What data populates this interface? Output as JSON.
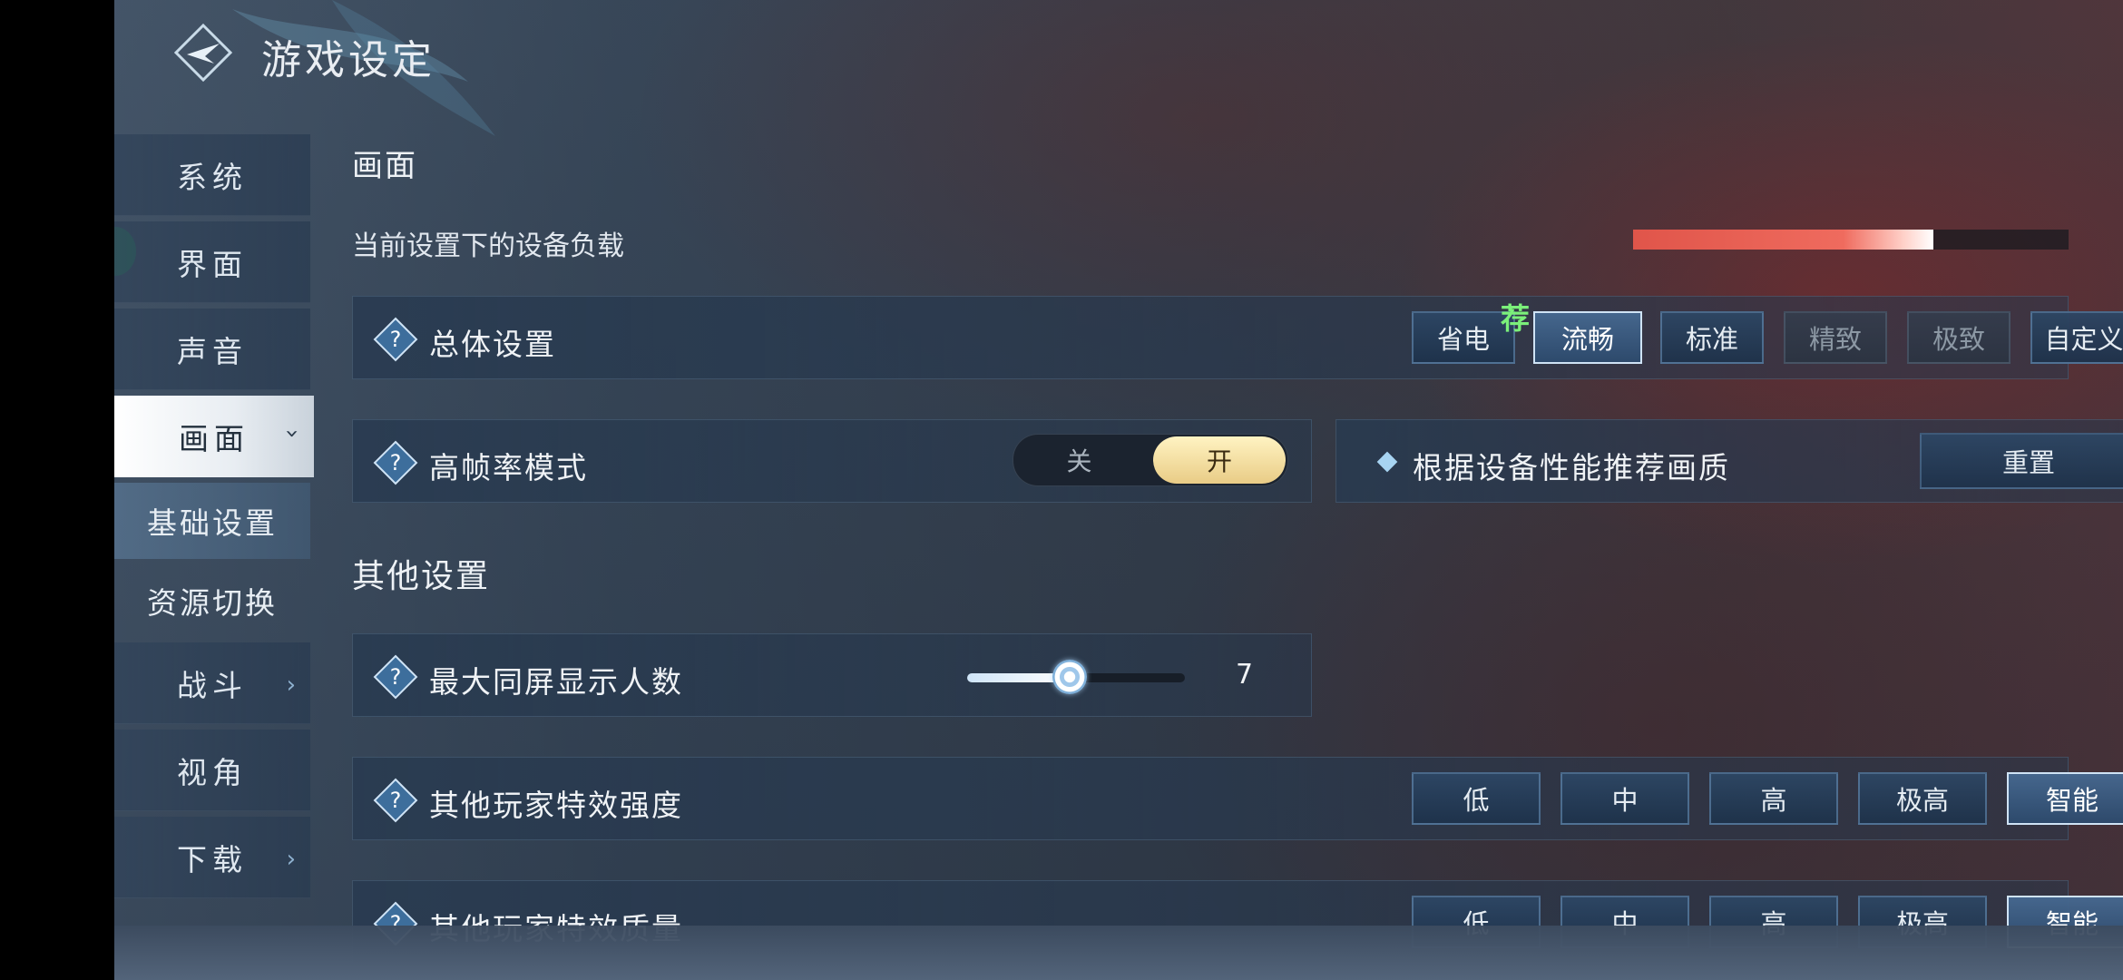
{
  "header": {
    "title": "游戏设定"
  },
  "sidebar": {
    "items": [
      {
        "label": "系统"
      },
      {
        "label": "界面"
      },
      {
        "label": "声音"
      },
      {
        "label": "画面"
      },
      {
        "label": "战斗"
      },
      {
        "label": "视角"
      },
      {
        "label": "下载"
      }
    ],
    "subitems": [
      {
        "label": "基础设置"
      },
      {
        "label": "资源切换"
      }
    ]
  },
  "main": {
    "section_picture": "画面",
    "device_load": {
      "label": "当前设置下的设备负载",
      "level": 0.69,
      "color": "#e0554a"
    },
    "overall": {
      "label": "总体设置",
      "recommended_tag": "荐",
      "options": [
        "省电",
        "流畅",
        "标准",
        "精致",
        "极致",
        "自定义"
      ],
      "selected": "流畅",
      "disabled": [
        "精致",
        "极致"
      ]
    },
    "high_fps": {
      "label": "高帧率模式",
      "off": "关",
      "on": "开",
      "state": "开"
    },
    "recommend": {
      "label": "根据设备性能推荐画质",
      "reset": "重置"
    },
    "section_other": "其他设置",
    "max_players": {
      "label": "最大同屏显示人数",
      "value": "7",
      "level": 0.47
    },
    "effect_strength": {
      "label": "其他玩家特效强度",
      "options": [
        "低",
        "中",
        "高",
        "极高",
        "智能"
      ],
      "selected": "智能"
    },
    "effect_quality": {
      "label": "其他玩家特效质量",
      "options": [
        "低",
        "中",
        "高",
        "极高",
        "智能"
      ],
      "selected": "智能"
    }
  },
  "colors": {
    "accent": "#cfe3f5",
    "recommend_green": "#7bf07a",
    "toggle_on": "#e9cc86"
  }
}
